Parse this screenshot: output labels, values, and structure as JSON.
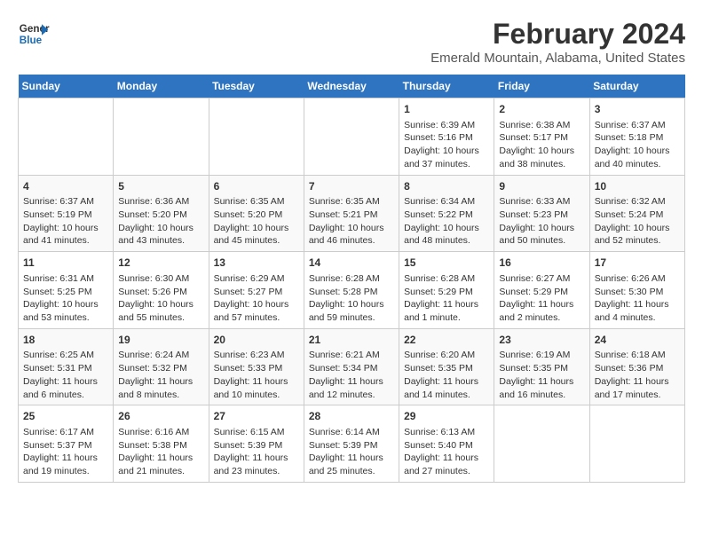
{
  "header": {
    "logo_line1": "General",
    "logo_line2": "Blue",
    "title": "February 2024",
    "location": "Emerald Mountain, Alabama, United States"
  },
  "days_of_week": [
    "Sunday",
    "Monday",
    "Tuesday",
    "Wednesday",
    "Thursday",
    "Friday",
    "Saturday"
  ],
  "weeks": [
    [
      {
        "day": "",
        "info": ""
      },
      {
        "day": "",
        "info": ""
      },
      {
        "day": "",
        "info": ""
      },
      {
        "day": "",
        "info": ""
      },
      {
        "day": "1",
        "info": "Sunrise: 6:39 AM\nSunset: 5:16 PM\nDaylight: 10 hours\nand 37 minutes."
      },
      {
        "day": "2",
        "info": "Sunrise: 6:38 AM\nSunset: 5:17 PM\nDaylight: 10 hours\nand 38 minutes."
      },
      {
        "day": "3",
        "info": "Sunrise: 6:37 AM\nSunset: 5:18 PM\nDaylight: 10 hours\nand 40 minutes."
      }
    ],
    [
      {
        "day": "4",
        "info": "Sunrise: 6:37 AM\nSunset: 5:19 PM\nDaylight: 10 hours\nand 41 minutes."
      },
      {
        "day": "5",
        "info": "Sunrise: 6:36 AM\nSunset: 5:20 PM\nDaylight: 10 hours\nand 43 minutes."
      },
      {
        "day": "6",
        "info": "Sunrise: 6:35 AM\nSunset: 5:20 PM\nDaylight: 10 hours\nand 45 minutes."
      },
      {
        "day": "7",
        "info": "Sunrise: 6:35 AM\nSunset: 5:21 PM\nDaylight: 10 hours\nand 46 minutes."
      },
      {
        "day": "8",
        "info": "Sunrise: 6:34 AM\nSunset: 5:22 PM\nDaylight: 10 hours\nand 48 minutes."
      },
      {
        "day": "9",
        "info": "Sunrise: 6:33 AM\nSunset: 5:23 PM\nDaylight: 10 hours\nand 50 minutes."
      },
      {
        "day": "10",
        "info": "Sunrise: 6:32 AM\nSunset: 5:24 PM\nDaylight: 10 hours\nand 52 minutes."
      }
    ],
    [
      {
        "day": "11",
        "info": "Sunrise: 6:31 AM\nSunset: 5:25 PM\nDaylight: 10 hours\nand 53 minutes."
      },
      {
        "day": "12",
        "info": "Sunrise: 6:30 AM\nSunset: 5:26 PM\nDaylight: 10 hours\nand 55 minutes."
      },
      {
        "day": "13",
        "info": "Sunrise: 6:29 AM\nSunset: 5:27 PM\nDaylight: 10 hours\nand 57 minutes."
      },
      {
        "day": "14",
        "info": "Sunrise: 6:28 AM\nSunset: 5:28 PM\nDaylight: 10 hours\nand 59 minutes."
      },
      {
        "day": "15",
        "info": "Sunrise: 6:28 AM\nSunset: 5:29 PM\nDaylight: 11 hours\nand 1 minute."
      },
      {
        "day": "16",
        "info": "Sunrise: 6:27 AM\nSunset: 5:29 PM\nDaylight: 11 hours\nand 2 minutes."
      },
      {
        "day": "17",
        "info": "Sunrise: 6:26 AM\nSunset: 5:30 PM\nDaylight: 11 hours\nand 4 minutes."
      }
    ],
    [
      {
        "day": "18",
        "info": "Sunrise: 6:25 AM\nSunset: 5:31 PM\nDaylight: 11 hours\nand 6 minutes."
      },
      {
        "day": "19",
        "info": "Sunrise: 6:24 AM\nSunset: 5:32 PM\nDaylight: 11 hours\nand 8 minutes."
      },
      {
        "day": "20",
        "info": "Sunrise: 6:23 AM\nSunset: 5:33 PM\nDaylight: 11 hours\nand 10 minutes."
      },
      {
        "day": "21",
        "info": "Sunrise: 6:21 AM\nSunset: 5:34 PM\nDaylight: 11 hours\nand 12 minutes."
      },
      {
        "day": "22",
        "info": "Sunrise: 6:20 AM\nSunset: 5:35 PM\nDaylight: 11 hours\nand 14 minutes."
      },
      {
        "day": "23",
        "info": "Sunrise: 6:19 AM\nSunset: 5:35 PM\nDaylight: 11 hours\nand 16 minutes."
      },
      {
        "day": "24",
        "info": "Sunrise: 6:18 AM\nSunset: 5:36 PM\nDaylight: 11 hours\nand 17 minutes."
      }
    ],
    [
      {
        "day": "25",
        "info": "Sunrise: 6:17 AM\nSunset: 5:37 PM\nDaylight: 11 hours\nand 19 minutes."
      },
      {
        "day": "26",
        "info": "Sunrise: 6:16 AM\nSunset: 5:38 PM\nDaylight: 11 hours\nand 21 minutes."
      },
      {
        "day": "27",
        "info": "Sunrise: 6:15 AM\nSunset: 5:39 PM\nDaylight: 11 hours\nand 23 minutes."
      },
      {
        "day": "28",
        "info": "Sunrise: 6:14 AM\nSunset: 5:39 PM\nDaylight: 11 hours\nand 25 minutes."
      },
      {
        "day": "29",
        "info": "Sunrise: 6:13 AM\nSunset: 5:40 PM\nDaylight: 11 hours\nand 27 minutes."
      },
      {
        "day": "",
        "info": ""
      },
      {
        "day": "",
        "info": ""
      }
    ]
  ]
}
